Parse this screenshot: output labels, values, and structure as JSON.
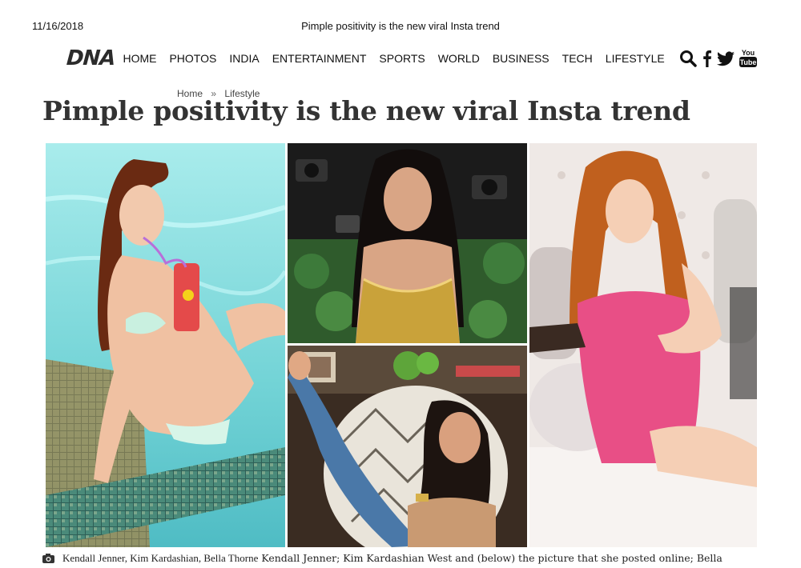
{
  "print_header": {
    "date": "11/16/2018",
    "title": "Pimple positivity is the new viral Insta trend"
  },
  "nav": {
    "logo": "DNA",
    "items": [
      "HOME",
      "PHOTOS",
      "INDIA",
      "ENTERTAINMENT",
      "SPORTS",
      "WORLD",
      "BUSINESS",
      "TECH",
      "LIFESTYLE"
    ],
    "icons": [
      "search-icon",
      "facebook-icon",
      "twitter-icon",
      "youtube-icon"
    ],
    "youtube_label_top": "You",
    "youtube_label_bottom": "Tube"
  },
  "breadcrumb": {
    "home": "Home",
    "separator": "»",
    "section": "Lifestyle"
  },
  "article": {
    "headline": "Pimple positivity is the new viral Insta trend",
    "caption_icon": "camera-icon",
    "caption_names": "Kendall Jenner, Kim Kardashian, Bella Thorne",
    "caption_text": "Kendall Jenner; Kim Kardashian West and (below) the picture that she posted online; Bella"
  },
  "colors": {
    "pool": "#7fd6d8",
    "gold": "#c9a23a",
    "pink_dress": "#e84f86",
    "headline": "#333333"
  }
}
